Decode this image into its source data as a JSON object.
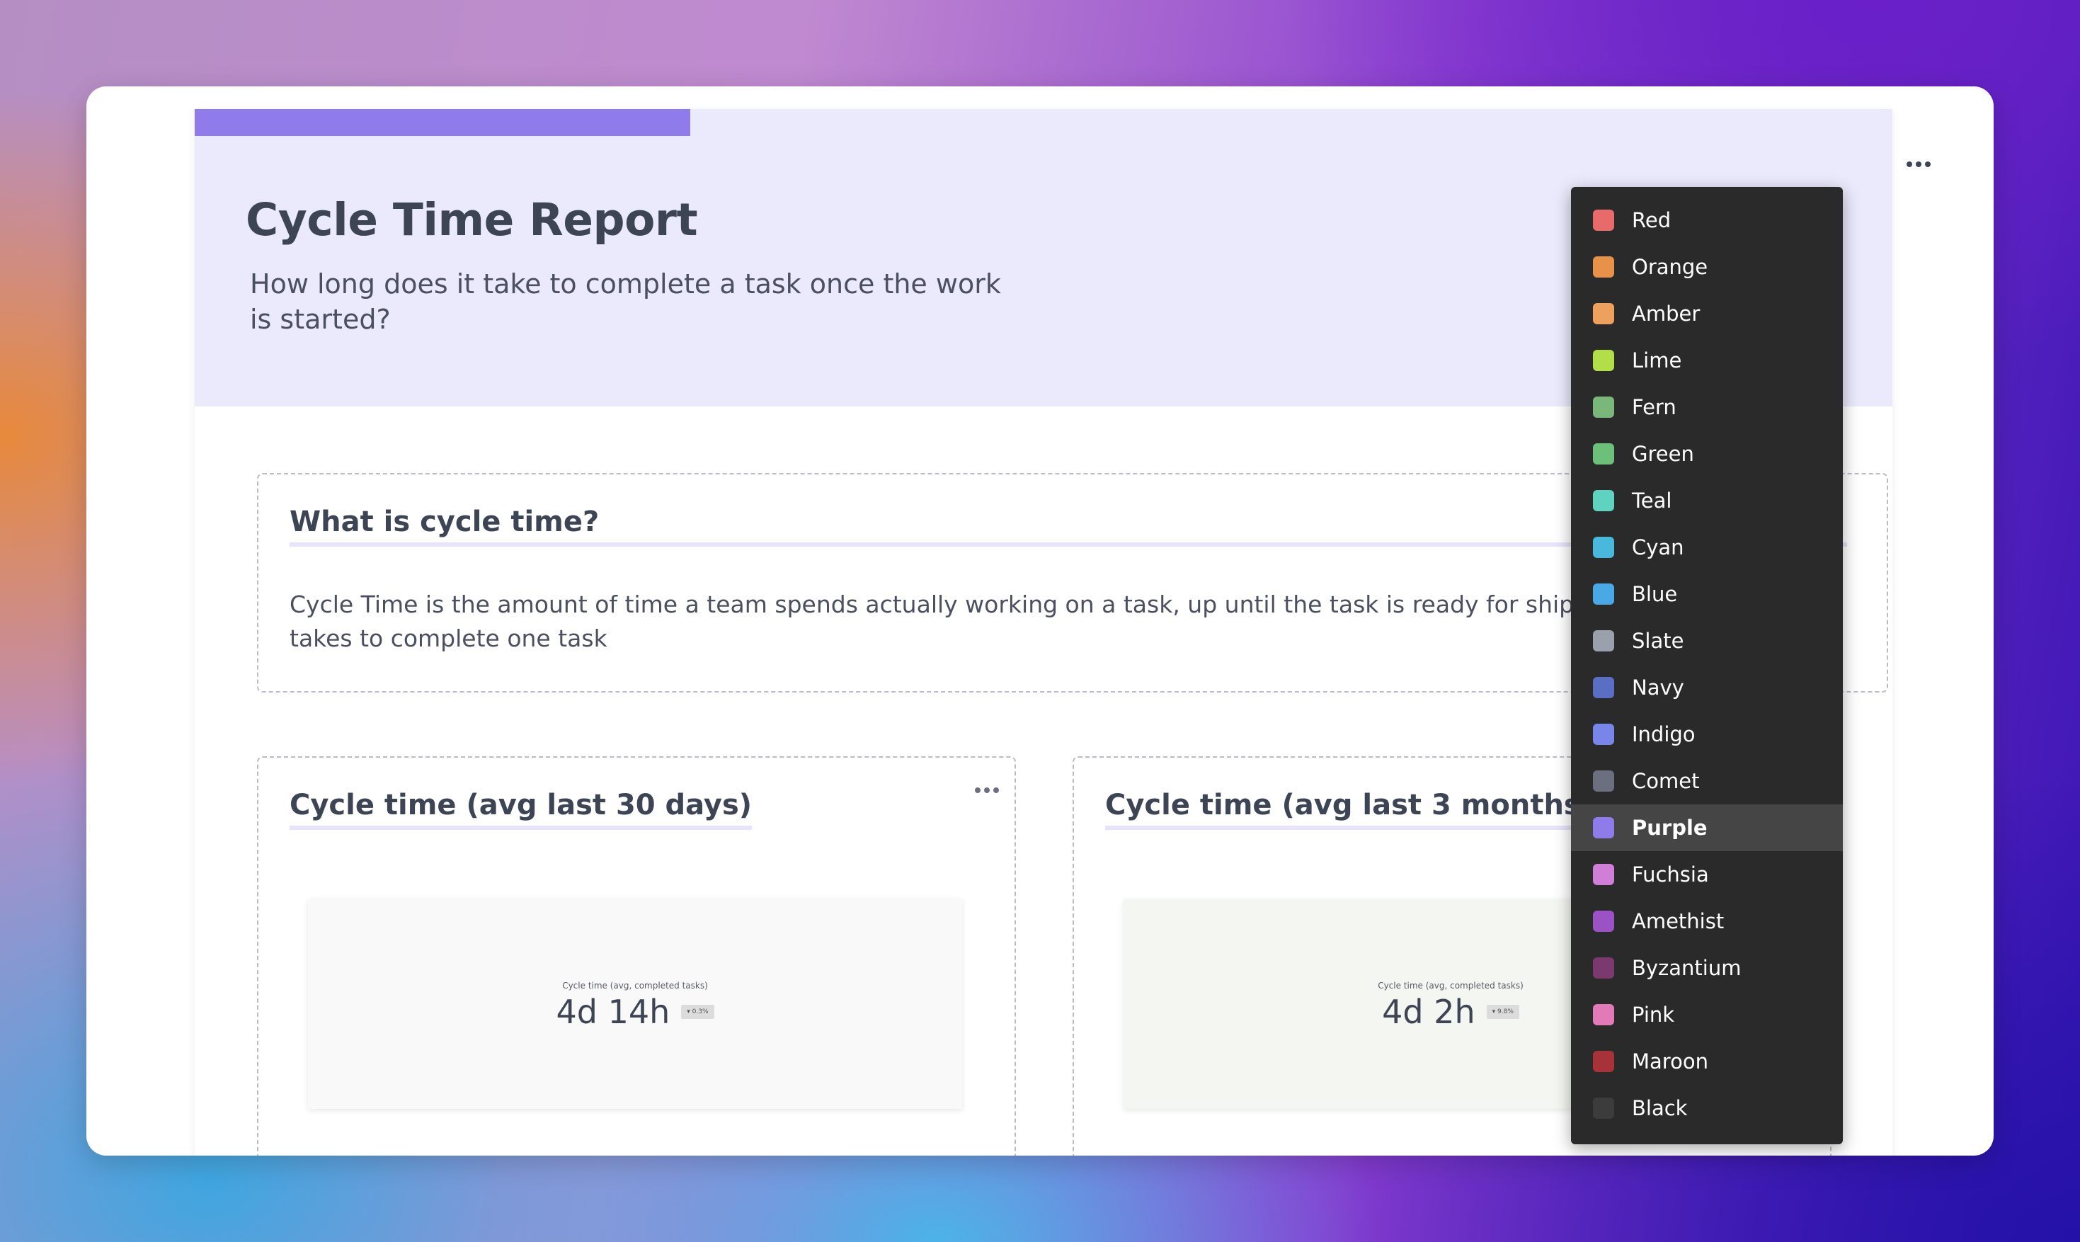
{
  "report": {
    "title": "Cycle Time Report",
    "subtitle": "How long does it take to complete a task once the work is started?",
    "accent_color": "#8f7be9",
    "header_bg": "#ebeafc"
  },
  "intro_card": {
    "heading": "What is cycle time?",
    "body_line1": "Cycle Time is the amount of time a team spends actually working on a task, up until the task is ready for shipmen",
    "body_line2": "takes to complete one task"
  },
  "cards": [
    {
      "heading": "Cycle time (avg last 30 days)",
      "metric_label": "Cycle time (avg, completed tasks)",
      "metric_value": "4d 14h",
      "metric_badge": "▾ 0.3%"
    },
    {
      "heading": "Cycle time (avg last 3 months)",
      "metric_label": "Cycle time (avg, completed tasks)",
      "metric_value": "4d 2h",
      "metric_badge": "▾ 9.8%"
    }
  ],
  "color_menu": {
    "selected": "Purple",
    "items": [
      {
        "label": "Red",
        "color": "#e86a6a"
      },
      {
        "label": "Orange",
        "color": "#e8914a"
      },
      {
        "label": "Amber",
        "color": "#eea05e"
      },
      {
        "label": "Lime",
        "color": "#b2de4a"
      },
      {
        "label": "Fern",
        "color": "#7ab77a"
      },
      {
        "label": "Green",
        "color": "#6cc07a"
      },
      {
        "label": "Teal",
        "color": "#5fd3c0"
      },
      {
        "label": "Cyan",
        "color": "#4ab8dc"
      },
      {
        "label": "Blue",
        "color": "#4aa9e4"
      },
      {
        "label": "Slate",
        "color": "#9aa0ac"
      },
      {
        "label": "Navy",
        "color": "#5a6fc4"
      },
      {
        "label": "Indigo",
        "color": "#7a85ea"
      },
      {
        "label": "Comet",
        "color": "#6b6f80"
      },
      {
        "label": "Purple",
        "color": "#8f7be9"
      },
      {
        "label": "Fuchsia",
        "color": "#d07ed8"
      },
      {
        "label": "Amethist",
        "color": "#9a52c4"
      },
      {
        "label": "Byzantium",
        "color": "#7a3a70"
      },
      {
        "label": "Pink",
        "color": "#e37ab8"
      },
      {
        "label": "Maroon",
        "color": "#a8323a"
      },
      {
        "label": "Black",
        "color": "#3c3c3c"
      }
    ]
  }
}
